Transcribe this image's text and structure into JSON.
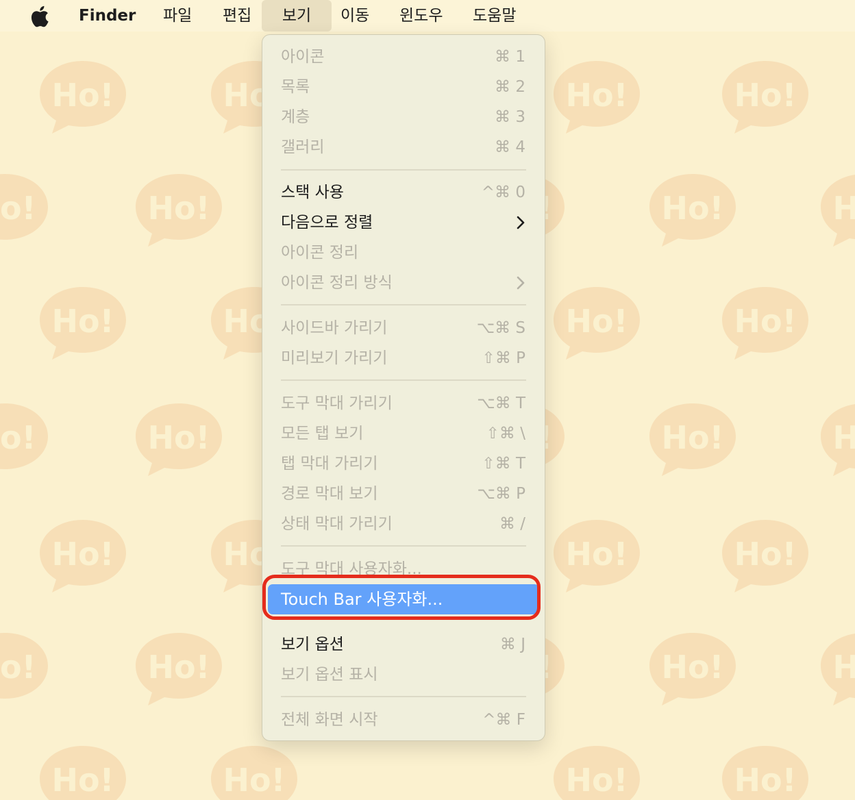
{
  "wallpaper": {
    "bubble_text": "Ho!"
  },
  "menubar": {
    "apple_icon": "apple-logo-icon",
    "app_name": "Finder",
    "items": [
      "파일",
      "편집",
      "보기",
      "이동",
      "윈도우",
      "도움말"
    ],
    "active": "보기"
  },
  "menu": {
    "groups": [
      [
        {
          "label": "아이콘",
          "shortcut": "⌘ 1",
          "enabled": false
        },
        {
          "label": "목록",
          "shortcut": "⌘ 2",
          "enabled": false
        },
        {
          "label": "계층",
          "shortcut": "⌘ 3",
          "enabled": false
        },
        {
          "label": "갤러리",
          "shortcut": "⌘ 4",
          "enabled": false
        }
      ],
      [
        {
          "label": "스택 사용",
          "shortcut": "^⌘ 0",
          "enabled": true
        },
        {
          "label": "다음으로 정렬",
          "submenu": true,
          "enabled": true
        },
        {
          "label": "아이콘 정리",
          "enabled": false
        },
        {
          "label": "아이콘 정리 방식",
          "submenu": true,
          "enabled": false
        }
      ],
      [
        {
          "label": "사이드바 가리기",
          "shortcut": "⌥⌘ S",
          "enabled": false
        },
        {
          "label": "미리보기 가리기",
          "shortcut": "⇧⌘ P",
          "enabled": false
        }
      ],
      [
        {
          "label": "도구 막대 가리기",
          "shortcut": "⌥⌘ T",
          "enabled": false
        },
        {
          "label": "모든 탭 보기",
          "shortcut": "⇧⌘ \\",
          "enabled": false
        },
        {
          "label": "탭 막대 가리기",
          "shortcut": "⇧⌘ T",
          "enabled": false
        },
        {
          "label": "경로 막대 보기",
          "shortcut": "⌥⌘ P",
          "enabled": false
        },
        {
          "label": "상태 막대 가리기",
          "shortcut": "⌘ /",
          "enabled": false
        }
      ],
      [
        {
          "label": "도구 막대 사용자화...",
          "enabled": false
        },
        {
          "label": "Touch Bar 사용자화...",
          "enabled": true,
          "highlighted": true
        }
      ],
      [
        {
          "label": "보기 옵션",
          "shortcut": "⌘ J",
          "enabled": true
        },
        {
          "label": "보기 옵션 표시",
          "enabled": false
        }
      ],
      [
        {
          "label": "전체 화면 시작",
          "shortcut": "^⌘ F",
          "enabled": false
        }
      ]
    ]
  },
  "colors": {
    "wallpaper": "#fbf1cf",
    "bubble": "#f7dfb7",
    "highlight": "#63a2fa",
    "callout_ring": "#e52c1c"
  }
}
